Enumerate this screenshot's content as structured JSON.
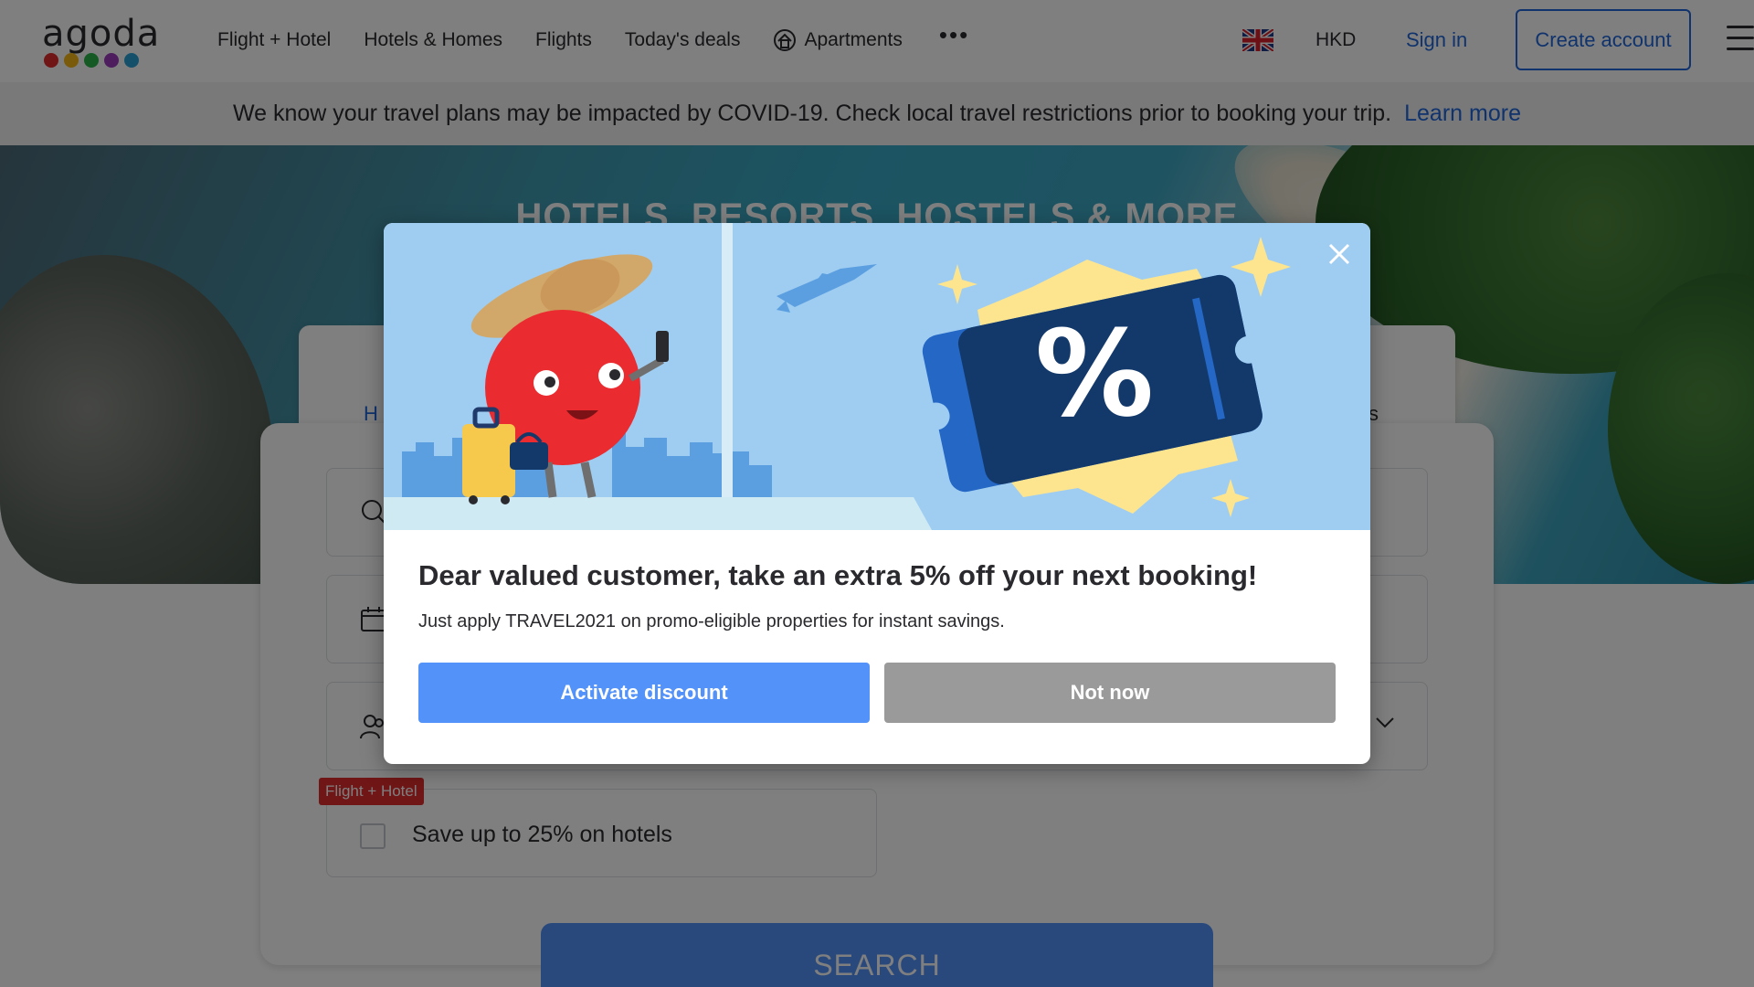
{
  "header": {
    "logo_text": "agoda",
    "logo_dot_colors": [
      "#e12d2d",
      "#f3b717",
      "#2ab34a",
      "#9b3bbd",
      "#2aa0d6"
    ],
    "nav": [
      "Flight + Hotel",
      "Hotels & Homes",
      "Flights",
      "Today's deals",
      "Apartments"
    ],
    "more_label": "•••",
    "currency": "HKD",
    "signin_label": "Sign in",
    "create_account_label": "Create account"
  },
  "banner": {
    "text": "We know your travel plans may be impacted by COVID-19. Check local travel restrictions prior to booking your trip.",
    "link_label": "Learn more"
  },
  "hero": {
    "title": "HOTELS, RESORTS, HOSTELS & MORE"
  },
  "search_panel": {
    "active_tab_partial": "H",
    "right_tab_partial": "s",
    "flight_hotel_tag": "Flight + Hotel",
    "flight_hotel_checkbox_label": "Save up to 25% on hotels",
    "flight_hotel_checked": false,
    "search_label": "SEARCH"
  },
  "modal": {
    "title": "Dear valued customer, take an extra 5% off your next booking!",
    "subtitle": "Just apply TRAVEL2021 on promo-eligible properties for instant savings.",
    "activate_label": "Activate discount",
    "not_now_label": "Not now",
    "illustration_symbol": "%"
  },
  "colors": {
    "brand_blue": "#2067da",
    "button_blue": "#5392f9",
    "button_gray": "#9a9a9a",
    "tag_red": "#e12d2d",
    "illustration_sky": "#9fcdf2",
    "ticket_navy": "#13396b",
    "badge_yellow": "#fde58f"
  }
}
